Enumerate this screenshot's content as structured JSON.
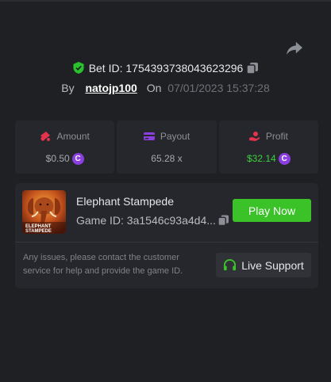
{
  "bet": {
    "label": "Bet ID: 1754393738043623296",
    "by_label": "By",
    "username": "natojp100",
    "on_label": "On",
    "datetime": "07/01/2023 15:37:28"
  },
  "stats": {
    "amount": {
      "label": "Amount",
      "value": "$0.50",
      "icon": "coins-icon"
    },
    "payout": {
      "label": "Payout",
      "value": "65.28 x",
      "icon": "wallet-icon"
    },
    "profit": {
      "label": "Profit",
      "value": "$32.14",
      "icon": "hand-coin-icon",
      "color": "#3ad13c"
    },
    "coin_symbol": "C"
  },
  "game": {
    "name": "Elephant Stampede",
    "id_text": "Game ID: 3a1546c93a4d4...",
    "thumb_text_line1": "ELEPHANT",
    "thumb_text_line2": "STAMPEDE",
    "play_label": "Play Now"
  },
  "support": {
    "message": "Any issues, please contact the customer service for help and provide the game ID.",
    "button_label": "Live Support"
  },
  "colors": {
    "accent_green": "#3bc229",
    "coin_purple": "#8b3fe0",
    "icon_red": "#e5334d",
    "icon_purple": "#8b3fe0"
  }
}
